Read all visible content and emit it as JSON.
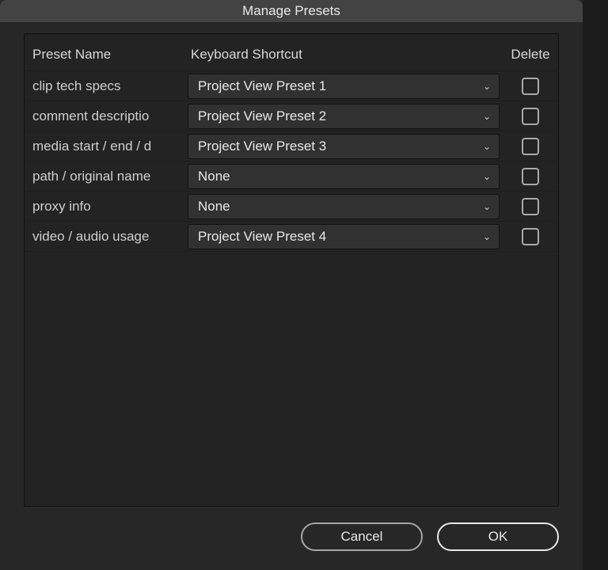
{
  "dialog": {
    "title": "Manage Presets"
  },
  "columns": {
    "name": "Preset Name",
    "shortcut": "Keyboard Shortcut",
    "delete": "Delete"
  },
  "rows": [
    {
      "name": "clip tech specs",
      "shortcut": "Project View Preset 1"
    },
    {
      "name": "comment descriptio",
      "shortcut": "Project View Preset 2"
    },
    {
      "name": "media start / end / d",
      "shortcut": "Project View Preset 3"
    },
    {
      "name": "path / original name",
      "shortcut": "None"
    },
    {
      "name": "proxy info",
      "shortcut": "None"
    },
    {
      "name": "video / audio usage",
      "shortcut": "Project View Preset 4"
    }
  ],
  "buttons": {
    "cancel": "Cancel",
    "ok": "OK"
  }
}
